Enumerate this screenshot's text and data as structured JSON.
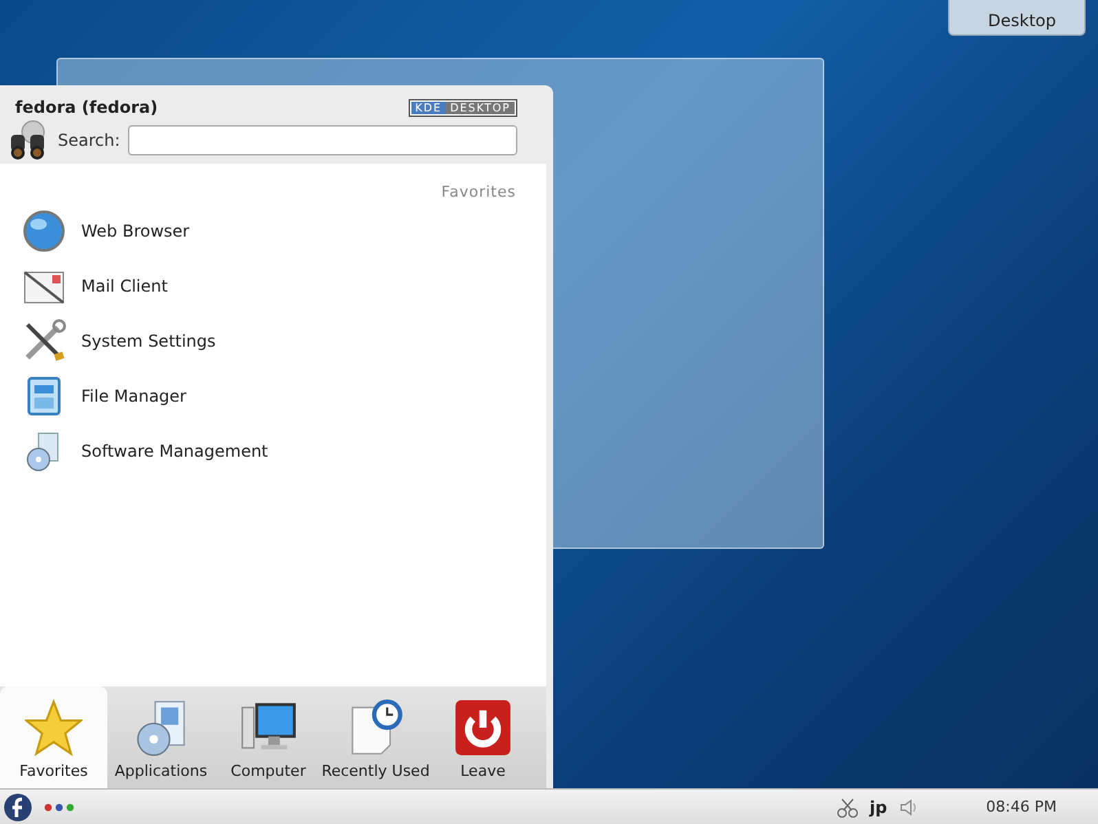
{
  "desktop_toolbox": {
    "label": "Desktop"
  },
  "launcher": {
    "user": "fedora (fedora)",
    "badge": [
      "KDE",
      "DESKTOP"
    ],
    "search": {
      "label": "Search:"
    },
    "section_title": "Favorites",
    "items": [
      {
        "kind": "globe",
        "label": "Web Browser"
      },
      {
        "kind": "mail",
        "label": "Mail Client"
      },
      {
        "kind": "tools",
        "label": "System Settings"
      },
      {
        "kind": "folder",
        "label": "File Manager"
      },
      {
        "kind": "package",
        "label": "Software Management"
      }
    ],
    "tabs": [
      {
        "kind": "star",
        "label": "Favorites",
        "selected": true
      },
      {
        "kind": "apps",
        "label": "Applications",
        "selected": false
      },
      {
        "kind": "computer",
        "label": "Computer",
        "selected": false
      },
      {
        "kind": "clock",
        "label": "Recently Used",
        "selected": false
      },
      {
        "kind": "power",
        "label": "Leave",
        "selected": false
      }
    ]
  },
  "taskbar": {
    "keyboard_layout": "jp",
    "clock": "08:46 PM"
  }
}
